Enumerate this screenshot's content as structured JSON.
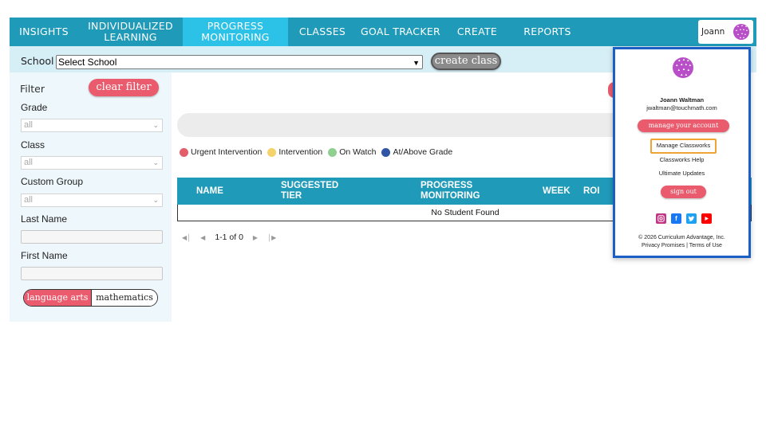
{
  "nav": {
    "items": [
      {
        "label": "INSIGHTS",
        "active": false
      },
      {
        "label_lines": [
          "INDIVIDUALIZED",
          "LEARNING"
        ],
        "active": false
      },
      {
        "label_lines": [
          "PROGRESS",
          "MONITORING"
        ],
        "active": true
      },
      {
        "label": "CLASSES",
        "active": false
      },
      {
        "label": "GOAL TRACKER",
        "active": false
      },
      {
        "label": "CREATE",
        "active": false
      },
      {
        "label": "REPORTS",
        "active": false
      }
    ],
    "user_name": "Joann"
  },
  "school_bar": {
    "label": "School",
    "selected": "Select School",
    "create_button": "create class"
  },
  "filter": {
    "title": "Filter",
    "clear_button": "clear filter",
    "grade_label": "Grade",
    "grade_value": "all",
    "class_label": "Class",
    "class_value": "all",
    "group_label": "Custom Group",
    "group_value": "all",
    "last_name_label": "Last Name",
    "first_name_label": "First Name",
    "subjects": [
      "language arts",
      "mathematics"
    ],
    "active_subject": "language arts"
  },
  "legend": [
    {
      "label": "Urgent Intervention",
      "color": "#e35d6a"
    },
    {
      "label": "Intervention",
      "color": "#f5d36b"
    },
    {
      "label": "On Watch",
      "color": "#8fcf8f"
    },
    {
      "label": "At/Above Grade",
      "color": "#2f55a4"
    }
  ],
  "table": {
    "columns": [
      {
        "lines": [
          "NAME"
        ]
      },
      {
        "lines": [
          "SUGGESTED",
          "TIER"
        ]
      },
      {
        "lines": [
          "PROGRESS",
          "MONITORING"
        ]
      },
      {
        "lines": [
          "WEEK"
        ]
      },
      {
        "lines": [
          "ROI"
        ]
      }
    ],
    "empty_message": "No Student Found"
  },
  "pager": {
    "range": "1-1 of 0"
  },
  "account_menu": {
    "name": "Joann Waltman",
    "email": "jwaltman@touchmath.com",
    "manage_account": "manage your account",
    "manage_classworks": "Manage Classworks",
    "help": "Classworks Help",
    "updates": "Ultimate Updates",
    "sign_out": "sign out",
    "social_icons": [
      "instagram-icon",
      "facebook-icon",
      "twitter-icon",
      "youtube-icon"
    ],
    "copyright": "© 2026 Curriculum Advantage, Inc.",
    "privacy": "Privacy Promises",
    "separator": "|",
    "terms": "Terms of Use"
  },
  "colors": {
    "nav_bg": "#1f9ab9",
    "nav_active": "#2cc1e6",
    "accent_pink": "#e95b6d",
    "panel_border": "#1b5fc6",
    "highlight": "#f0a431"
  }
}
